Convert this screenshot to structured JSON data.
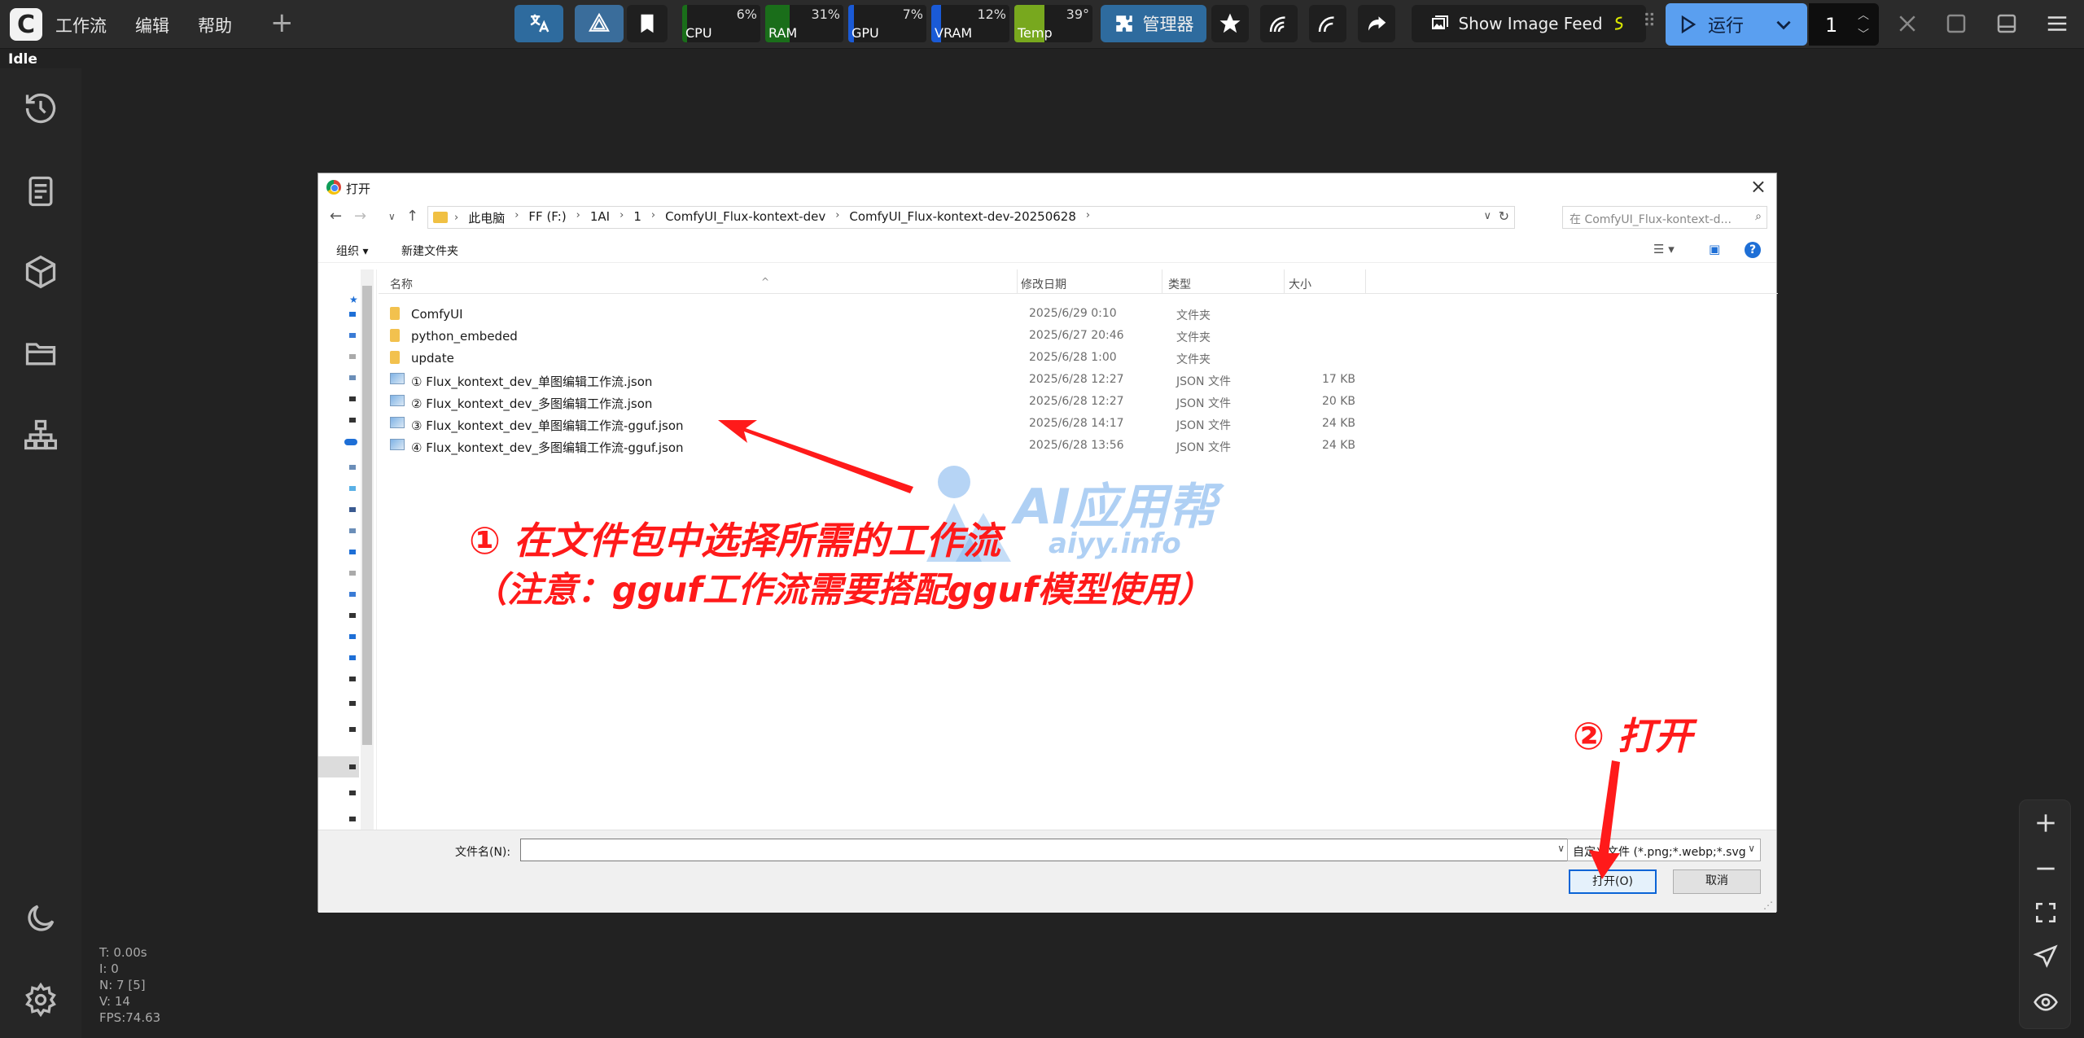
{
  "menu": {
    "workflow": "工作流",
    "edit": "编辑",
    "help": "帮助"
  },
  "meters": [
    {
      "name": "CPU",
      "pct": "6%",
      "color": "#1a6e1a",
      "value": 0.06
    },
    {
      "name": "RAM",
      "pct": "31%",
      "color": "#1a6e1a",
      "value": 0.31
    },
    {
      "name": "GPU",
      "pct": "7%",
      "color": "#1a5ad6",
      "value": 0.07
    },
    {
      "name": "VRAM",
      "pct": "12%",
      "color": "#1a5ad6",
      "value": 0.12
    },
    {
      "name": "Temp",
      "pct": "39°",
      "color": "#78a81e",
      "value": 0.39
    }
  ],
  "toolbar": {
    "manager": "管理器",
    "show_image_feed": "Show Image Feed",
    "run": "运行",
    "queue_count": "1"
  },
  "status": "Idle",
  "stats": {
    "t": "T: 0.00s",
    "i": "I: 0",
    "n": "N: 7 [5]",
    "v": "V: 14",
    "fps": "FPS:74.63"
  },
  "dialog": {
    "title": "打开",
    "path": [
      "此电脑",
      "FF (F:)",
      "1AI",
      "1",
      "ComfyUI_Flux-kontext-dev",
      "ComfyUI_Flux-kontext-dev-20250628"
    ],
    "search_placeholder": "在 ComfyUI_Flux-kontext-d...",
    "organize": "组织 ▾",
    "new_folder": "新建文件夹",
    "columns": {
      "name": "名称",
      "date": "修改日期",
      "type": "类型",
      "size": "大小"
    },
    "files": [
      {
        "name": "ComfyUI",
        "date": "2025/6/29 0:10",
        "type": "文件夹",
        "size": "",
        "kind": "folder"
      },
      {
        "name": "python_embeded",
        "date": "2025/6/27 20:46",
        "type": "文件夹",
        "size": "",
        "kind": "folder"
      },
      {
        "name": "update",
        "date": "2025/6/28 1:00",
        "type": "文件夹",
        "size": "",
        "kind": "folder"
      },
      {
        "name": "① Flux_kontext_dev_单图编辑工作流.json",
        "date": "2025/6/28 12:27",
        "type": "JSON 文件",
        "size": "17 KB",
        "kind": "json"
      },
      {
        "name": "② Flux_kontext_dev_多图编辑工作流.json",
        "date": "2025/6/28 12:27",
        "type": "JSON 文件",
        "size": "20 KB",
        "kind": "json"
      },
      {
        "name": "③ Flux_kontext_dev_单图编辑工作流-gguf.json",
        "date": "2025/6/28 14:17",
        "type": "JSON 文件",
        "size": "24 KB",
        "kind": "json"
      },
      {
        "name": "④ Flux_kontext_dev_多图编辑工作流-gguf.json",
        "date": "2025/6/28 13:56",
        "type": "JSON 文件",
        "size": "24 KB",
        "kind": "json"
      }
    ],
    "filename_label": "文件名(N):",
    "filename_value": "",
    "filter": "自定义文件 (*.png;*.webp;*.svg",
    "open": "打开(O)",
    "cancel": "取消"
  },
  "annotations": {
    "step1_line1": "① 在文件包中选择所需的工作流",
    "step1_line2": "（注意：gguf工作流需要搭配gguf模型使用）",
    "step2": "② 打开"
  },
  "watermark": {
    "brand": "AI应用帮",
    "url": "aiyy.info"
  }
}
